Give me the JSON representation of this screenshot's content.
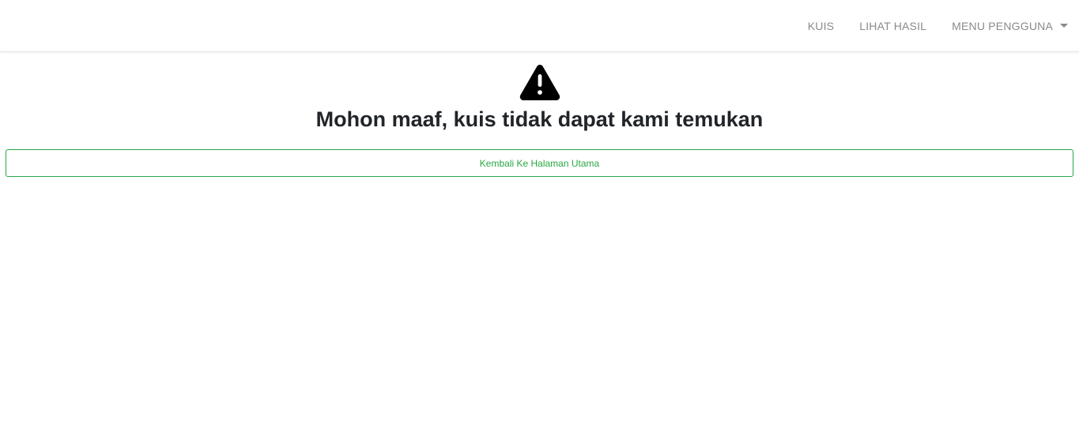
{
  "navbar": {
    "links": [
      {
        "label": "KUIS"
      },
      {
        "label": "LIHAT HASIL"
      },
      {
        "label": "MENU PENGGUNA",
        "has_dropdown": true
      }
    ]
  },
  "main": {
    "icon": "warning-triangle-icon",
    "title": "Mohon maaf, kuis tidak dapat kami temukan",
    "back_button_label": "Kembali Ke Halaman Utama"
  },
  "colors": {
    "accent": "#28a745",
    "nav_text": "#8a8a8a",
    "title_text": "#212529",
    "icon": "#000000"
  }
}
